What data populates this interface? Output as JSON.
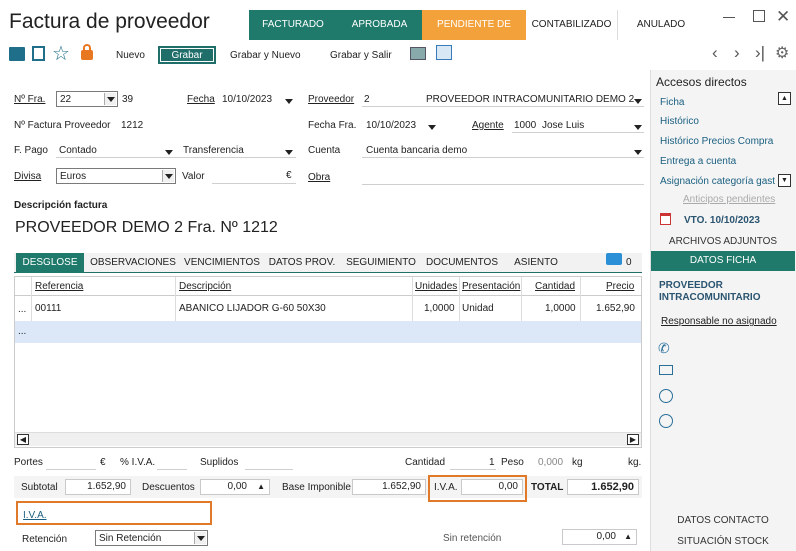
{
  "window": {
    "title": "Factura de proveedor",
    "minimize_icon": "minimize-icon",
    "maximize_icon": "maximize-icon",
    "close_icon": "close-icon"
  },
  "status_tabs": [
    {
      "label": "FACTURADO",
      "color": "#1f7a6b"
    },
    {
      "label": "APROBADA",
      "color": "#1f7a6b"
    },
    {
      "label": "PENDIENTE DE PAGO",
      "color": "#f3a23b"
    },
    {
      "label": "CONTABILIZADO",
      "color": "#ffffff"
    },
    {
      "label": "ANULADO",
      "color": "#ffffff"
    }
  ],
  "toolbar": {
    "nuevo": "Nuevo",
    "grabar": "Grabar",
    "grabar_nuevo": "Grabar y Nuevo",
    "grabar_salir": "Grabar y Salir"
  },
  "form": {
    "num_fra_label": "Nº Fra.",
    "num_fra_serie": "22",
    "num_fra_number": "39",
    "fecha_label": "Fecha",
    "fecha_value": "10/10/2023",
    "proveedor_label": "Proveedor",
    "proveedor_code": "2",
    "proveedor_name": "PROVEEDOR INTRACOMUNITARIO DEMO 2",
    "num_factura_prov_label": "Nº Factura Proveedor",
    "num_factura_prov_value": "1212",
    "fecha_fra_label": "Fecha Fra.",
    "fecha_fra_value": "10/10/2023",
    "agente_label": "Agente",
    "agente_code": "1000",
    "agente_name": "Jose Luis",
    "fpago_label": "F. Pago",
    "fpago_value": "Contado",
    "fpago_tipo": "Transferencia",
    "cuenta_label": "Cuenta",
    "cuenta_value": "Cuenta bancaria demo",
    "divisa_label": "Divisa",
    "divisa_value": "Euros",
    "valor_label": "Valor",
    "valor_symbol": "€",
    "obra_label": "Obra",
    "descripcion_label": "Descripción factura",
    "descripcion_value": "PROVEEDOR DEMO 2 Fra. Nº 1212"
  },
  "tabs": [
    "DESGLOSE",
    "OBSERVACIONES",
    "VENCIMIENTOS",
    "DATOS PROV.",
    "SEGUIMIENTO",
    "DOCUMENTOS",
    "ASIENTO"
  ],
  "comment_count": "0",
  "grid": {
    "headers": [
      "Referencia",
      "Descripción",
      "Unidades",
      "Presentación",
      "Cantidad",
      "Precio"
    ],
    "rows": [
      {
        "marker": "...",
        "ref": "00111",
        "desc": "ABANICO LIJADOR G-60 50X30",
        "unidades": "1,0000",
        "presentacion": "Unidad",
        "cantidad": "1,0000",
        "precio": "1.652,90"
      },
      {
        "marker": "...",
        "ref": "",
        "desc": "",
        "unidades": "",
        "presentacion": "",
        "cantidad": "",
        "precio": ""
      }
    ]
  },
  "footer": {
    "portes_label": "Portes",
    "euro_symbol": "€",
    "piva_label": "% I.V.A.",
    "suplidos_label": "Suplidos",
    "cantidad_label": "Cantidad",
    "cantidad_value": "1",
    "peso_label": "Peso",
    "peso_value": "0,000",
    "peso_unit": "kg",
    "peso_unit2": "kg.",
    "subtotal_label": "Subtotal",
    "subtotal_value": "1.652,90",
    "descuentos_label": "Descuentos",
    "descuentos_value": "0,00",
    "base_label": "Base Imponible",
    "base_value": "1.652,90",
    "iva_label": "I.V.A.",
    "iva_value": "0,00",
    "total_label": "TOTAL",
    "total_value": "1.652,90",
    "iva_link": "I.V.A.",
    "retencion_label": "Retención",
    "retencion_value": "Sin Retención",
    "sin_retencion_label": "Sin retención",
    "sin_retencion_value": "0,00"
  },
  "sidebar": {
    "accesos_title": "Accesos directos",
    "links": [
      "Ficha",
      "Histórico",
      "Histórico Precios Compra",
      "Entrega a cuenta",
      "Asignación categoría gast"
    ],
    "anticipos": "Anticipos pendientes",
    "vto": "VTO. 10/10/2023",
    "archivos": "ARCHIVOS ADJUNTOS",
    "datos_ficha": "DATOS FICHA",
    "proveedor": "PROVEEDOR INTRACOMUNITARIO",
    "responsable": "Responsable no asignado",
    "datos_contacto": "DATOS CONTACTO",
    "situacion_stock": "SITUACIÓN STOCK"
  }
}
